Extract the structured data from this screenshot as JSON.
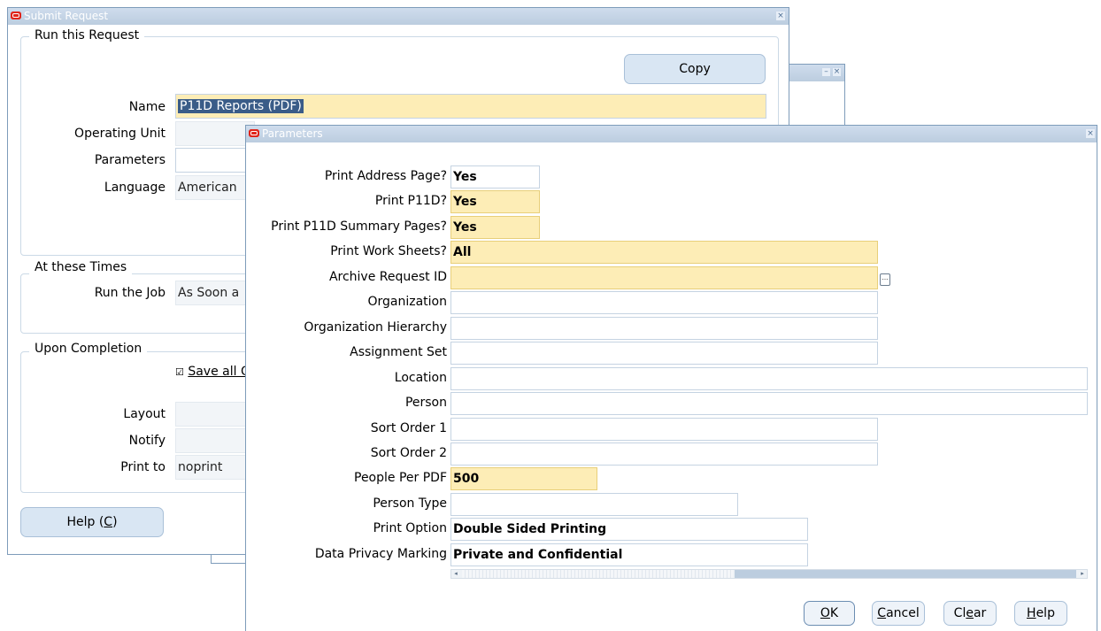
{
  "submit_request": {
    "title": "Submit Request",
    "run_section": "Run this Request",
    "copy_label": "Copy",
    "name_label": "Name",
    "name_value": "P11D Reports (PDF)",
    "operating_unit_label": "Operating Unit",
    "parameters_label": "Parameters",
    "language_label": "Language",
    "language_value": "American",
    "times_section": "At these Times",
    "run_job_label": "Run the Job",
    "run_job_value": "As Soon a",
    "completion_section": "Upon Completion",
    "save_checkbox_label": "Save all O",
    "layout_label": "Layout",
    "notify_label": "Notify",
    "print_to_label": "Print to",
    "print_to_value": "noprint",
    "help_label": "Help (",
    "help_key": "C",
    "help_close": ")"
  },
  "parameters": {
    "title": "Parameters",
    "fields": [
      {
        "label": "Print Address Page?",
        "value": "Yes"
      },
      {
        "label": "Print P11D?",
        "value": "Yes"
      },
      {
        "label": "Print P11D Summary Pages?",
        "value": "Yes"
      },
      {
        "label": "Print Work Sheets?",
        "value": "All"
      },
      {
        "label": "Archive Request ID",
        "value": ""
      },
      {
        "label": "Organization",
        "value": ""
      },
      {
        "label": "Organization Hierarchy",
        "value": ""
      },
      {
        "label": "Assignment Set",
        "value": ""
      },
      {
        "label": "Location",
        "value": ""
      },
      {
        "label": "Person",
        "value": ""
      },
      {
        "label": "Sort Order 1",
        "value": ""
      },
      {
        "label": "Sort Order 2",
        "value": ""
      },
      {
        "label": "People Per PDF",
        "value": "500"
      },
      {
        "label": "Person Type",
        "value": ""
      },
      {
        "label": "Print Option",
        "value": "Double Sided Printing"
      },
      {
        "label": "Data Privacy Marking",
        "value": "Private and Confidential"
      }
    ],
    "lov_button": "...",
    "buttons": {
      "ok_key": "O",
      "ok_rest": "K",
      "cancel_key": "C",
      "cancel_rest": "ancel",
      "clear_pre": "Cl",
      "clear_key": "e",
      "clear_rest": "ar",
      "help_key": "H",
      "help_rest": "elp"
    }
  },
  "colors": {
    "required_field": "#fdedb6",
    "titlebar": "#c7d6e7",
    "button": "#d9e6f3"
  }
}
